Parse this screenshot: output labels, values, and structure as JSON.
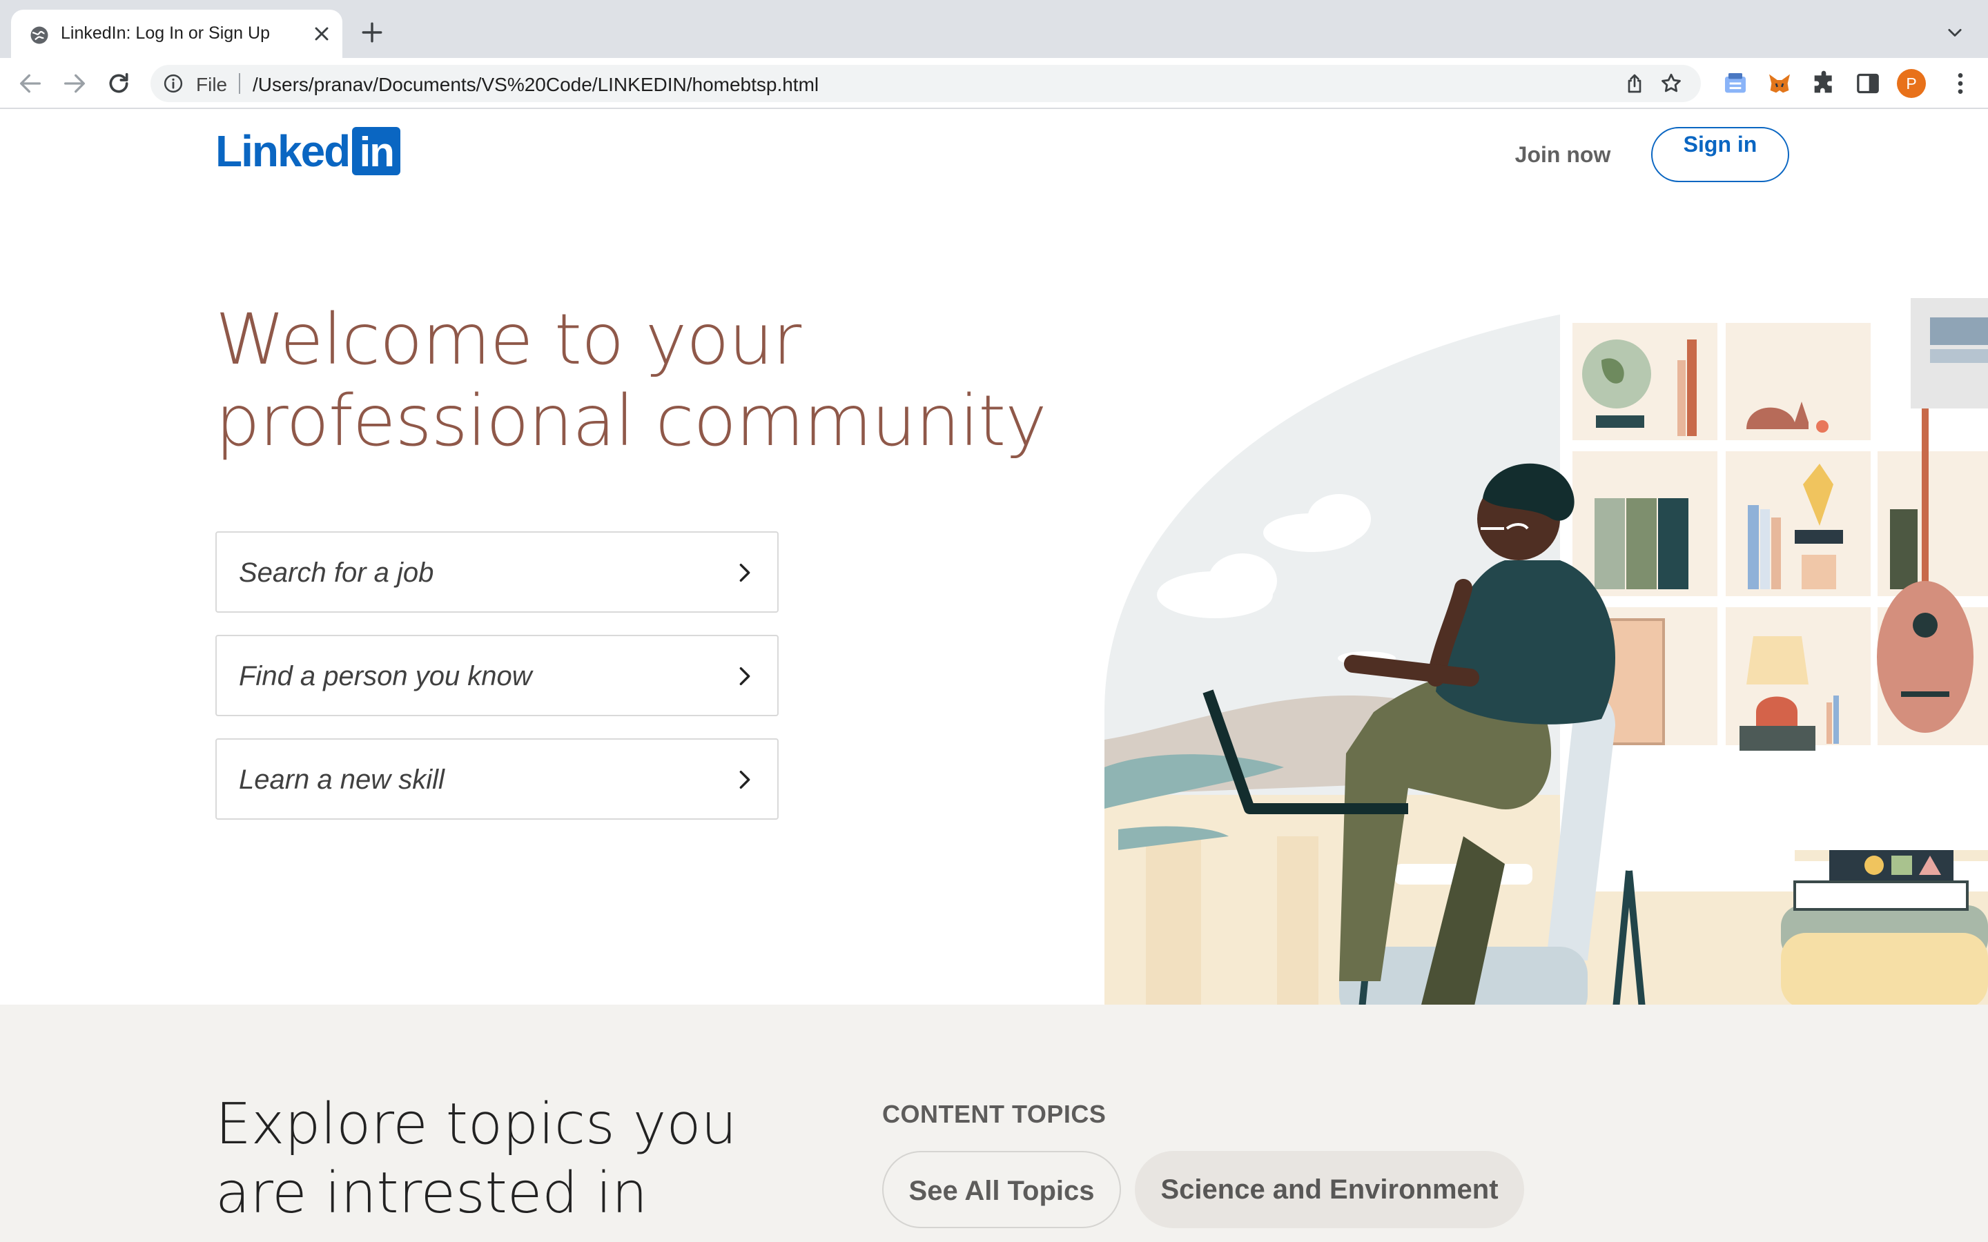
{
  "browser": {
    "tab_title": "LinkedIn: Log In or Sign Up",
    "scheme_label": "File",
    "url": "/Users/pranav/Documents/VS%20Code/LINKEDIN/homebtsp.html",
    "profile_initial": "P"
  },
  "header": {
    "logo_word": "Linked",
    "logo_box": "in",
    "join_now": "Join now",
    "sign_in": "Sign in"
  },
  "hero": {
    "title_line1": "Welcome to your",
    "title_line2": "professional community",
    "actions": [
      {
        "label": "Search for a job"
      },
      {
        "label": "Find a person you know"
      },
      {
        "label": "Learn a new skill"
      }
    ]
  },
  "explore": {
    "title_line1": "Explore topics you",
    "title_line2": "are intrested in",
    "content_topics_label": "CONTENT TOPICS",
    "topics": [
      "See All Topics",
      "Science and Environment"
    ]
  },
  "colors": {
    "brand_blue": "#0a66c2",
    "hero_title": "#8f5849",
    "explore_bg": "#f3f2ef"
  }
}
